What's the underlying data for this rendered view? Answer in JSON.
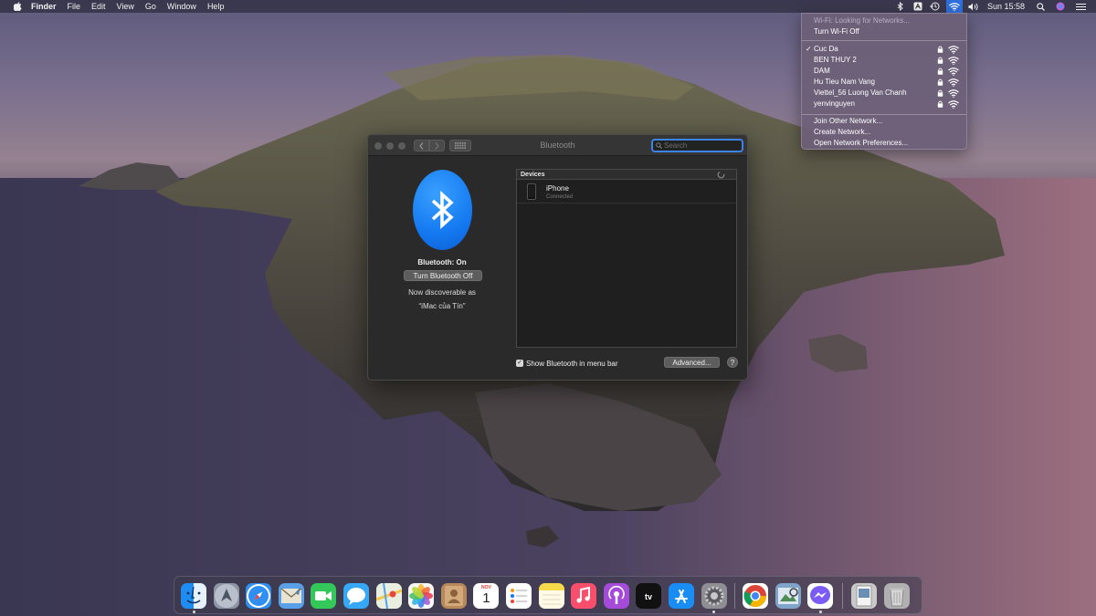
{
  "menubar": {
    "app_name": "Finder",
    "menus": [
      "File",
      "Edit",
      "View",
      "Go",
      "Window",
      "Help"
    ],
    "clock": "Sun 15:58",
    "status_icons": [
      "bluetooth-icon",
      "keyboard-input-icon",
      "time-machine-icon",
      "wifi-icon",
      "volume-icon",
      "spotlight-search-icon",
      "siri-icon",
      "control-icon"
    ]
  },
  "bluetooth_window": {
    "title": "Bluetooth",
    "search_placeholder": "Search",
    "status": "Bluetooth: On",
    "toggle_label": "Turn Bluetooth Off",
    "discoverable_line1": "Now discoverable as",
    "discoverable_line2": "“iMac của Tín”",
    "devices_header": "Devices",
    "devices": [
      {
        "name": "iPhone",
        "status": "Connected"
      }
    ],
    "show_in_menubar_label": "Show Bluetooth in menu bar",
    "show_in_menubar_checked": true,
    "advanced_label": "Advanced...",
    "help_label": "?"
  },
  "wifi_menu": {
    "status": "Wi-Fi: Looking for Networks...",
    "toggle": "Turn Wi-Fi Off",
    "networks": [
      {
        "name": "Cuc Da",
        "selected": true,
        "locked": true
      },
      {
        "name": "BEN THUY 2",
        "selected": false,
        "locked": true
      },
      {
        "name": "DAM",
        "selected": false,
        "locked": true
      },
      {
        "name": "Hu Tieu Nam Vang",
        "selected": false,
        "locked": true
      },
      {
        "name": "Viettel_56 Luong Van Chanh",
        "selected": false,
        "locked": true
      },
      {
        "name": "yenvinguyen",
        "selected": false,
        "locked": true
      }
    ],
    "actions": [
      "Join Other Network...",
      "Create Network...",
      "Open Network Preferences..."
    ]
  },
  "dock": {
    "apps": [
      {
        "name": "Finder",
        "icon": "finder-icon",
        "color": "#1e8cf0",
        "running": true
      },
      {
        "name": "Launchpad",
        "icon": "launchpad-icon",
        "color": "#8d96a4",
        "running": false
      },
      {
        "name": "Safari",
        "icon": "safari-icon",
        "color": "#2f8ff3",
        "running": false
      },
      {
        "name": "Mail",
        "icon": "mail-icon",
        "color": "#5aa0e8",
        "running": false
      },
      {
        "name": "FaceTime",
        "icon": "facetime-icon",
        "color": "#34c759",
        "running": false
      },
      {
        "name": "Messages",
        "icon": "messages-icon",
        "color": "#36a8f5",
        "running": false
      },
      {
        "name": "Maps",
        "icon": "maps-icon",
        "color": "#7dc76a",
        "running": false
      },
      {
        "name": "Photos",
        "icon": "photos-icon",
        "color": "#f7f7f7",
        "running": false
      },
      {
        "name": "Contacts",
        "icon": "contacts-icon",
        "color": "#b8875a",
        "running": false
      },
      {
        "name": "Calendar",
        "icon": "calendar-icon",
        "color": "#ffffff",
        "running": false,
        "month": "NOV",
        "day": "1"
      },
      {
        "name": "Reminders",
        "icon": "reminders-icon",
        "color": "#ffffff",
        "running": false
      },
      {
        "name": "Notes",
        "icon": "notes-icon",
        "color": "#f6d94a",
        "running": false
      },
      {
        "name": "Music",
        "icon": "music-icon",
        "color": "#fb4e6c",
        "running": false
      },
      {
        "name": "Podcasts",
        "icon": "podcasts-icon",
        "color": "#a64ad9",
        "running": false
      },
      {
        "name": "TV",
        "icon": "tv-icon",
        "color": "#111111",
        "running": false
      },
      {
        "name": "App Store",
        "icon": "app-store-icon",
        "color": "#1a8df5",
        "running": false
      },
      {
        "name": "System Preferences",
        "icon": "system-preferences-icon",
        "color": "#8e8e93",
        "running": true
      },
      {
        "name": "Google Chrome",
        "icon": "chrome-icon",
        "color": "#ffffff",
        "running": false
      },
      {
        "name": "Preview",
        "icon": "preview-icon",
        "color": "#7fa3c9",
        "running": false
      },
      {
        "name": "Messenger",
        "icon": "messenger-icon",
        "color": "#ffffff",
        "running": true
      },
      {
        "name": "Downloads",
        "icon": "downloads-stack-icon",
        "color": "#c9c9c9",
        "running": false
      },
      {
        "name": "Trash",
        "icon": "trash-icon",
        "color": "#b0b0b0",
        "running": false
      }
    ]
  }
}
